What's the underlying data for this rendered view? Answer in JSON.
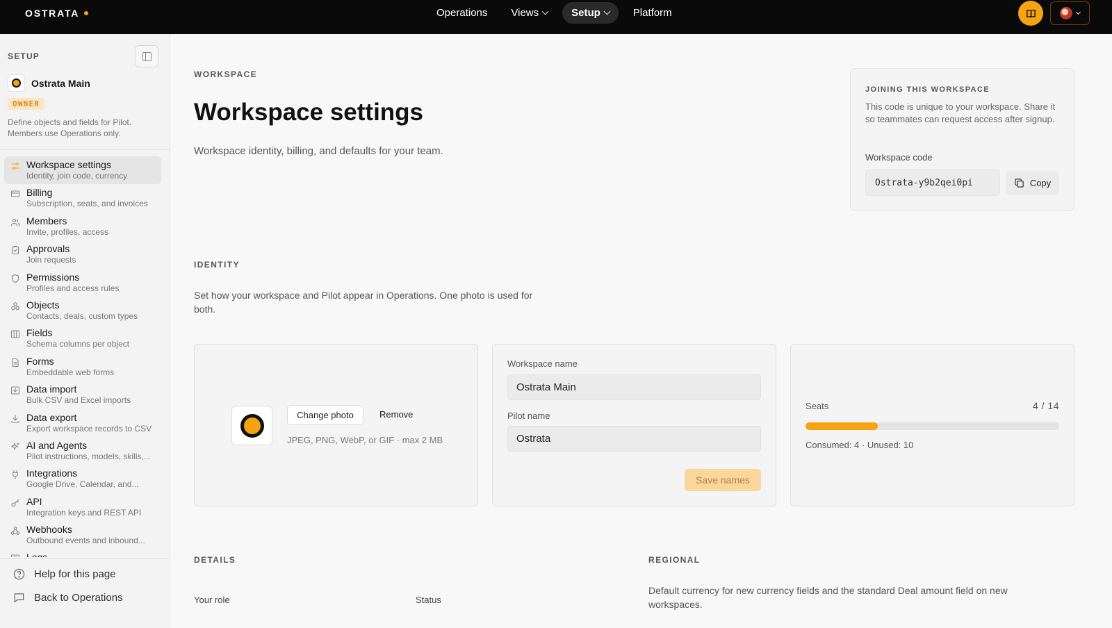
{
  "app": {
    "logo": "OSTRATA"
  },
  "topnav": [
    {
      "label": "Operations",
      "dropdown": false,
      "active": false
    },
    {
      "label": "Views",
      "dropdown": true,
      "active": false
    },
    {
      "label": "Setup",
      "dropdown": true,
      "active": true
    },
    {
      "label": "Platform",
      "dropdown": false,
      "active": false
    }
  ],
  "colors": {
    "accent": "#f6a313",
    "topbar": "#0a0a0a",
    "sidebar": "#f3f3f3"
  },
  "sidebar": {
    "title": "SETUP",
    "workspace_name": "Ostrata Main",
    "role_badge": "OWNER",
    "description": "Define objects and fields for Pilot. Members use Operations only.",
    "items": [
      {
        "label": "Workspace settings",
        "sub": "Identity, join code, currency",
        "icon": "sliders-icon",
        "active": true
      },
      {
        "label": "Billing",
        "sub": "Subscription, seats, and invoices",
        "icon": "card-icon",
        "active": false
      },
      {
        "label": "Members",
        "sub": "Invite, profiles, access",
        "icon": "users-icon",
        "active": false
      },
      {
        "label": "Approvals",
        "sub": "Join requests",
        "icon": "clipboard-icon",
        "active": false
      },
      {
        "label": "Permissions",
        "sub": "Profiles and access rules",
        "icon": "shield-icon",
        "active": false
      },
      {
        "label": "Objects",
        "sub": "Contacts, deals, custom types",
        "icon": "cubes-icon",
        "active": false
      },
      {
        "label": "Fields",
        "sub": "Schema columns per object",
        "icon": "columns-icon",
        "active": false
      },
      {
        "label": "Forms",
        "sub": "Embeddable web forms",
        "icon": "form-icon",
        "active": false
      },
      {
        "label": "Data import",
        "sub": "Bulk CSV and Excel imports",
        "icon": "import-icon",
        "active": false
      },
      {
        "label": "Data export",
        "sub": "Export workspace records to CSV",
        "icon": "download-icon",
        "active": false
      },
      {
        "label": "AI and Agents",
        "sub": "Pilot instructions, models, skills,...",
        "icon": "sparkle-icon",
        "active": false
      },
      {
        "label": "Integrations",
        "sub": "Google Drive, Calendar, and...",
        "icon": "plug-icon",
        "active": false
      },
      {
        "label": "API",
        "sub": "Integration keys and REST API",
        "icon": "key-icon",
        "active": false
      },
      {
        "label": "Webhooks",
        "sub": "Outbound events and inbound...",
        "icon": "webhook-icon",
        "active": false
      },
      {
        "label": "Logs",
        "sub": "",
        "icon": "logs-icon",
        "active": false
      }
    ],
    "help_label": "Help for this page",
    "back_label": "Back to Operations"
  },
  "main": {
    "eyebrow": "WORKSPACE",
    "title": "Workspace settings",
    "subtitle": "Workspace identity, billing, and defaults for your team.",
    "join": {
      "eyebrow": "JOINING THIS WORKSPACE",
      "description": "This code is unique to your workspace. Share it so teammates can request access after signup.",
      "code_label": "Workspace code",
      "code": "Ostrata-y9b2qei0pi",
      "copy_label": "Copy"
    },
    "identity": {
      "eyebrow": "IDENTITY",
      "description": "Set how your workspace and Pilot appear in Operations. One photo is used for both.",
      "change_photo": "Change photo",
      "remove": "Remove",
      "photo_hint": "JPEG, PNG, WebP, or GIF · max 2 MB",
      "workspace_name_label": "Workspace name",
      "workspace_name_value": "Ostrata Main",
      "pilot_name_label": "Pilot name",
      "pilot_name_value": "Ostrata",
      "save_names": "Save names"
    },
    "seats": {
      "label": "Seats",
      "count": "4 / 14",
      "used": 4,
      "total": 14,
      "meta": "Consumed: 4 · Unused: 10"
    },
    "details": {
      "eyebrow": "DETAILS",
      "role_label": "Your role",
      "status_label": "Status"
    },
    "regional": {
      "eyebrow": "REGIONAL",
      "description": "Default currency for new currency fields and the standard Deal amount field on new workspaces."
    }
  }
}
